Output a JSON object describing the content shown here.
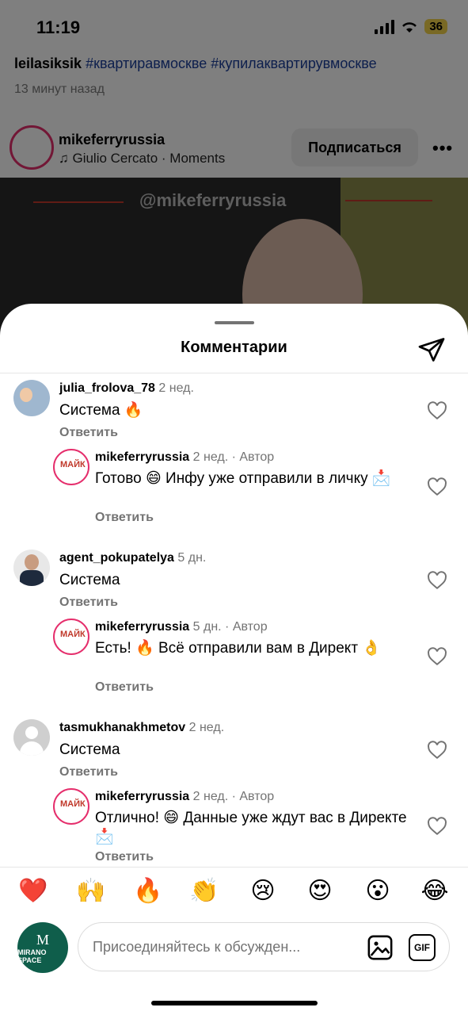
{
  "status_bar": {
    "time": "11:19",
    "battery": "36"
  },
  "post": {
    "caption_user": "leilasiksik",
    "caption_tags": "#квартиравмоскве #купилаквартирувмоскве",
    "time_ago": "13 минут назад",
    "author": "mikeferryrussia",
    "song": "♫ Giulio Cercato · Moments",
    "follow_label": "Подписаться",
    "more_label": "•••",
    "watermark": "@mikeferryrussia"
  },
  "sheet": {
    "title": "Комментарии"
  },
  "comments": [
    {
      "user": "julia_frolova_78",
      "when": "2 нед.",
      "text": "Система 🔥",
      "reply": "Ответить",
      "avatar": "julia"
    },
    {
      "user": "mikeferryrussia",
      "when": "2 нед. · Автор",
      "text": "Готово 😄 Инфу уже отправили в личку 📩",
      "reply": "Ответить",
      "avatar": "brand"
    },
    {
      "user": "agent_pokupatelya",
      "when": "5 дн.",
      "text": "Система",
      "reply": "Ответить",
      "avatar": "agent"
    },
    {
      "user": "mikeferryrussia",
      "when": "5 дн. · Автор",
      "text": "Есть! 🔥 Всё отправили вам в Директ 👌",
      "reply": "Ответить",
      "avatar": "brand"
    },
    {
      "user": "tasmukhanakhmetov",
      "when": "2 нед.",
      "text": "Система",
      "reply": "Ответить",
      "avatar": "default"
    },
    {
      "user": "mikeferryrussia",
      "when": "2 нед. · Автор",
      "text": "Отлично! 😄 Данные уже ждут вас в Директе 📩",
      "reply": "Ответить",
      "avatar": "brand"
    }
  ],
  "reactions": [
    "❤️",
    "🙌",
    "🔥",
    "👏",
    "😢",
    "😍",
    "😮",
    "😂"
  ],
  "composer": {
    "placeholder": "Присоединяйтесь к обсужден...",
    "gif_label": "GIF",
    "me_avatar_mark": "M",
    "me_avatar_name": "MIRANO SPACE"
  }
}
